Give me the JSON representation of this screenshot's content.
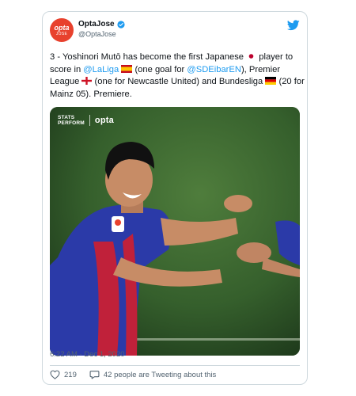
{
  "account": {
    "display_name": "OptaJose",
    "handle": "@OptaJose",
    "avatar_text": "opta",
    "avatar_subtext": "JOSE"
  },
  "tweet": {
    "p1": "3 - Yoshinori Mutō has become the first Japanese ",
    "p2": " player to score in ",
    "laliga": "@LaLiga",
    "p3": " (one goal for ",
    "eibar": "@SDEibarEN",
    "p4": "), Premier League ",
    "p5": " (one for Newcastle United) and Bundesliga ",
    "p6": " (20 for Mainz 05). Premiere."
  },
  "media": {
    "brand_stats_line1": "STATS",
    "brand_stats_line2": "PERFORM",
    "brand_opta": "opta"
  },
  "timestamp": "6:22 AM · Dec 1, 2020",
  "actions": {
    "likes": "219",
    "tweeting": "42 people are Tweeting about this"
  },
  "colors": {
    "link": "#1d9bf0",
    "avatar": "#e8412d",
    "muted": "#536471"
  }
}
